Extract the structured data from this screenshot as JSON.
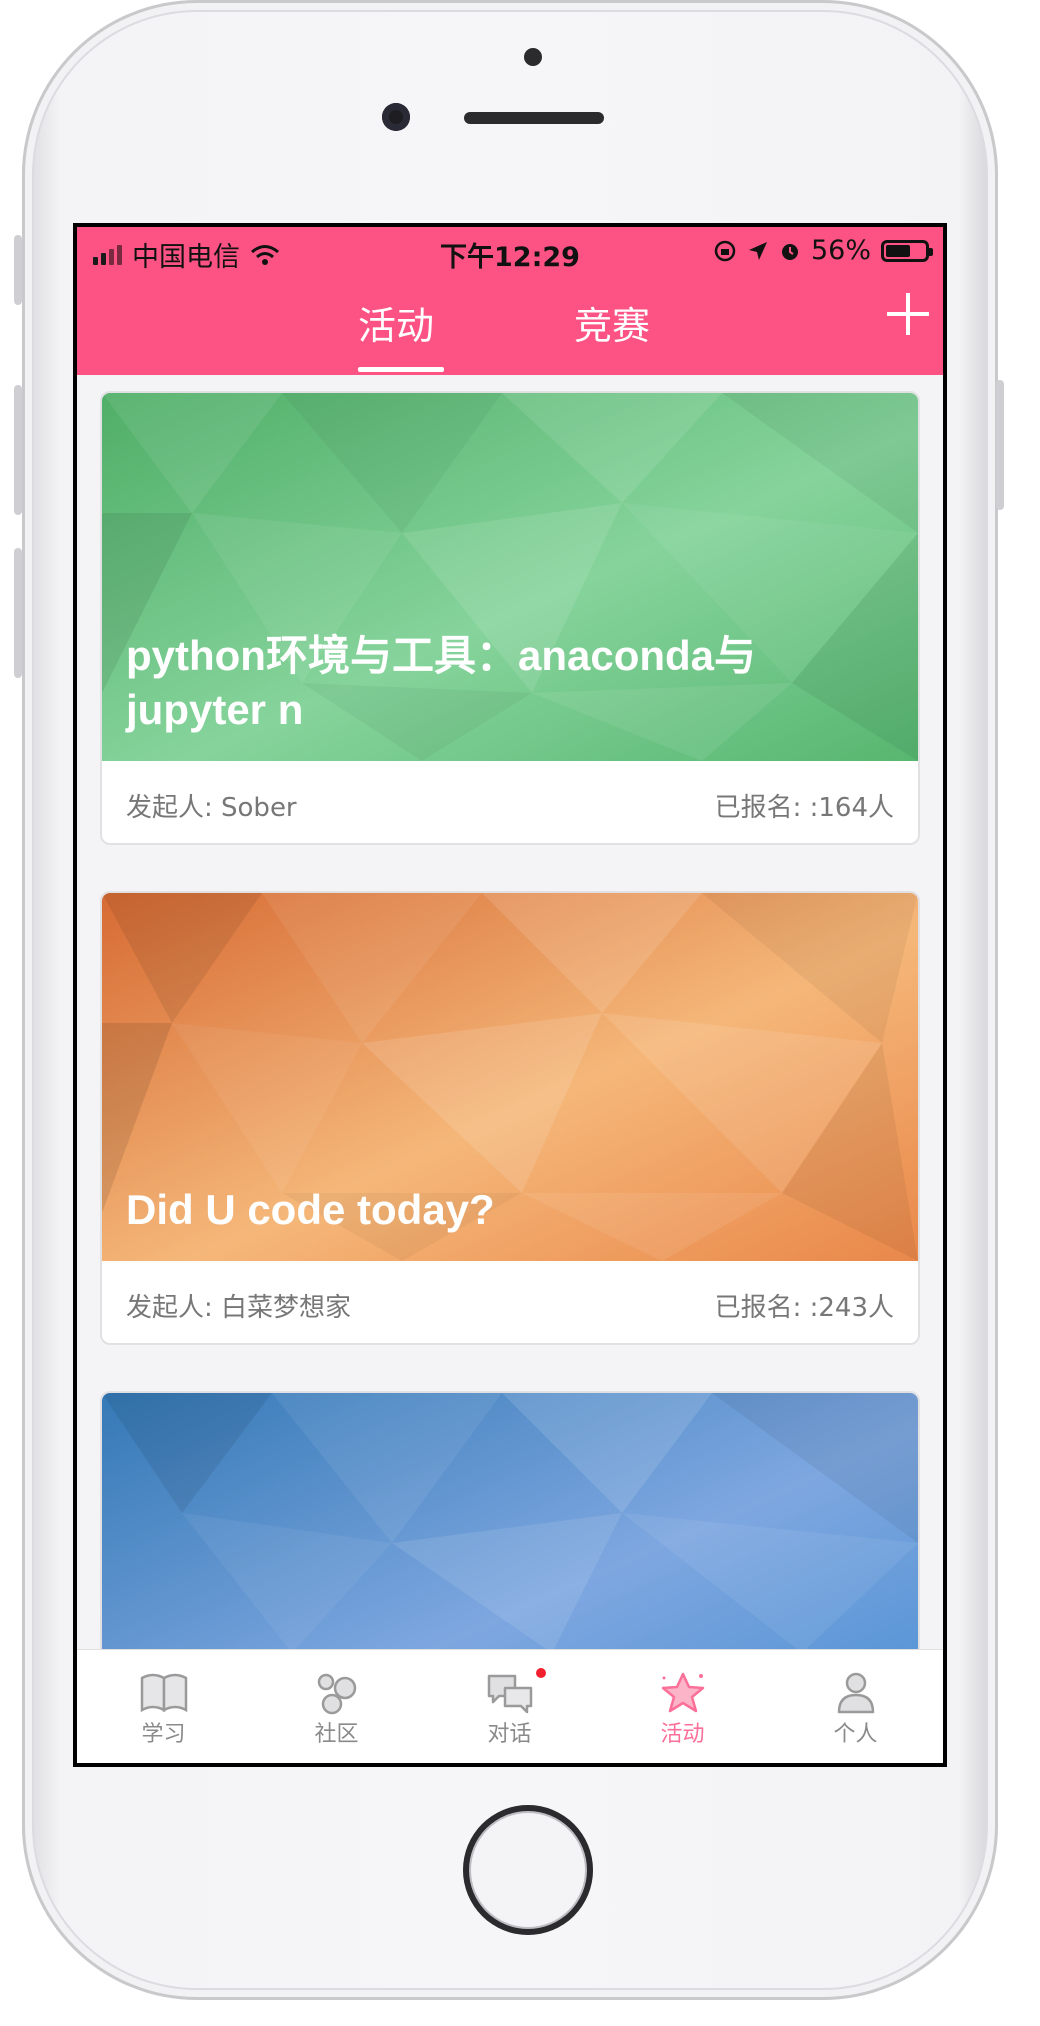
{
  "status_bar": {
    "carrier": "中国电信",
    "time": "下午12:29",
    "battery": "56%",
    "battery_level": 0.56
  },
  "header": {
    "tabs": [
      {
        "label": "活动",
        "active": true
      },
      {
        "label": "竞赛",
        "active": false
      }
    ],
    "add_icon": "plus-icon"
  },
  "cards": [
    {
      "title": "python环境与工具：anaconda与jupyter n",
      "organizer": "发起人: Sober",
      "enrolled": "已报名: :164人",
      "theme": "green",
      "colors": [
        "#5fbf7a",
        "#8ed7a2"
      ]
    },
    {
      "title": "Did U code today?",
      "organizer": "发起人: 白菜梦想家",
      "enrolled": "已报名: :243人",
      "theme": "orange",
      "colors": [
        "#e8793e",
        "#f6c08e"
      ]
    },
    {
      "title": "",
      "theme": "blue",
      "colors": [
        "#4a8fd0",
        "#8ab4e8"
      ]
    }
  ],
  "tabbar": {
    "items": [
      {
        "label": "学习",
        "icon": "book-icon"
      },
      {
        "label": "社区",
        "icon": "community-icon"
      },
      {
        "label": "对话",
        "icon": "chat-icon",
        "badge": true
      },
      {
        "label": "活动",
        "icon": "star-icon",
        "active": true
      },
      {
        "label": "个人",
        "icon": "person-icon"
      }
    ]
  },
  "colors": {
    "accent": "#fc5384",
    "active_tab": "#fb6f98"
  }
}
